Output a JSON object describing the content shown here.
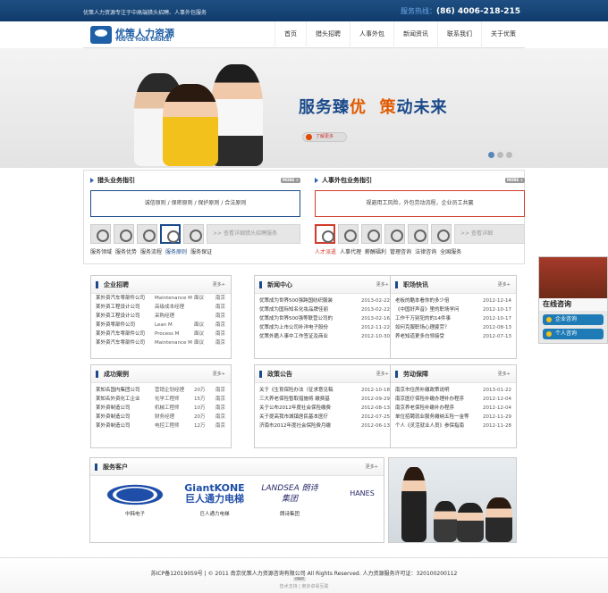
{
  "topbar": {
    "tagline": "优策人力资源专注于中高端猎头招聘、人事外包服务",
    "hotline_label": "服务热线：",
    "hotline_number": "(86) 4006-218-215"
  },
  "logo": {
    "cn": "优策人力资源",
    "en": "YOU'CE YOUR CHOICE!"
  },
  "nav": {
    "items": [
      "首页",
      "猎头招聘",
      "人事外包",
      "新闻资讯",
      "联系我们",
      "关于优策"
    ]
  },
  "hero": {
    "slogan_a": "服务臻",
    "slogan_b": "优",
    "slogan_c": "策",
    "slogan_d": "动未来",
    "more_label": "了解更多"
  },
  "headhunt": {
    "title": "猎头业务指引",
    "more": "MORE +",
    "principles": "诚信原则 / 保密原则 / 保护原则 / 合法原则",
    "view_label": ">> 查看详细猎头招聘服务",
    "labels": [
      "服务领域",
      "服务优势",
      "服务流程",
      "服务原则",
      "服务保证"
    ]
  },
  "outsourcing": {
    "title": "人事外包业务指引",
    "more": "MORE +",
    "principles": "规避用工风险，外包劳动流程，企业员工共赢",
    "view_label": ">> 查看详细",
    "labels": [
      "人才派遣",
      "人事代理",
      "薪酬福利",
      "管理咨询",
      "法律咨询",
      "全国服务"
    ]
  },
  "jobs": {
    "title": "企业招聘",
    "more": "更多+",
    "rows": [
      {
        "company": "某外资汽车零部件公司",
        "position": "Maintenance M",
        "type": "面议",
        "city": "南京"
      },
      {
        "company": "某外资工程设计公司",
        "position": "高级成本经理",
        "type": "",
        "city": "南京"
      },
      {
        "company": "某外资工程设计公司",
        "position": "采购经理",
        "type": "",
        "city": "南京"
      },
      {
        "company": "某外资零部件公司",
        "position": "Lean M",
        "type": "面议",
        "city": "南京"
      },
      {
        "company": "某外资汽车零部件公司",
        "position": "Process M",
        "type": "面议",
        "city": "南京"
      },
      {
        "company": "某外资汽车零部件公司",
        "position": "Maintenance M",
        "type": "面议",
        "city": "南京"
      }
    ]
  },
  "news": {
    "title": "新闻中心",
    "more": "更多+",
    "rows": [
      {
        "title": "优策成为世界500强跨国纺织服装",
        "date": "2013-02-22"
      },
      {
        "title": "优策成为国际知名化妆品牌佳丽",
        "date": "2013-02-22"
      },
      {
        "title": "优策成为世界500强等联营公司的",
        "date": "2013-02-16"
      },
      {
        "title": "优策成为上市公司补洋电子股份",
        "date": "2012-11-22"
      },
      {
        "title": "优策外籍人事中工作签证及商业",
        "date": "2012-10-30"
      }
    ]
  },
  "express": {
    "title": "职场快讯",
    "more": "更多+",
    "rows": [
      {
        "title": "老板的酷本看你的多少倍",
        "date": "2012-12-14"
      },
      {
        "title": "《中国好声音》里的职场学问",
        "date": "2012-10-17"
      },
      {
        "title": "工作千万别犯的的14件事",
        "date": "2012-10-17"
      },
      {
        "title": "如何克服职场心理疲劳？",
        "date": "2012-08-13"
      },
      {
        "title": "养老知道更多白领接受",
        "date": "2012-07-13"
      }
    ]
  },
  "cases": {
    "title": "成功案例",
    "more": "更多+",
    "rows": [
      {
        "company": "某知名国内集团公司",
        "position": "营销企划经理",
        "salary": "20万",
        "city": "南京"
      },
      {
        "company": "某知名外资化工企业",
        "position": "化学工程师",
        "salary": "15万",
        "city": "南京"
      },
      {
        "company": "某外资制造公司",
        "position": "机械工程师",
        "salary": "10万",
        "city": "南京"
      },
      {
        "company": "某外资制造公司",
        "position": "财务经理",
        "salary": "20万",
        "city": "南京"
      },
      {
        "company": "某外资制造公司",
        "position": "电控工程师",
        "salary": "12万",
        "city": "南京"
      }
    ]
  },
  "policy": {
    "title": "政策公告",
    "more": "更多+",
    "rows": [
      {
        "title": "关于《生育保险办法（征求意见稿",
        "date": "2012-10-18"
      },
      {
        "title": "三大养老保险暂取措施将 缴费基",
        "date": "2012-09-29"
      },
      {
        "title": "关于公布2012年度社会保险缴费",
        "date": "2012-08-13"
      },
      {
        "title": "关于提高我市城镇居民基本医疗",
        "date": "2012-07-25"
      },
      {
        "title": "济南市2012年度社会保险费月缴",
        "date": "2012-06-13"
      }
    ]
  },
  "labor": {
    "title": "劳动保障",
    "more": "更多+",
    "rows": [
      {
        "title": "南京市住房补缴政策说明",
        "date": "2013-01-22"
      },
      {
        "title": "南京医疗保险补缴办理补办程序",
        "date": "2012-12-04"
      },
      {
        "title": "南京养老保险补缴补办程序",
        "date": "2012-12-04"
      },
      {
        "title": "单位招聘就业服务缴纳五险一金等",
        "date": "2012-11-29"
      },
      {
        "title": "个人《灵活就业人员》参保指南",
        "date": "2012-11-28"
      }
    ]
  },
  "clients": {
    "title": "服务客户",
    "more": "更多+",
    "items": [
      {
        "logo": "",
        "name": "中韩电子"
      },
      {
        "logo": "GiantKONE 巨人通力电梯",
        "name": "巨人通力电梯"
      },
      {
        "logo": "LANDSEA 朗诗集团",
        "name": "朗诗集团"
      },
      {
        "logo": "HANES",
        "name": ""
      }
    ]
  },
  "side": {
    "title": "在线咨询",
    "btn1": "企业咨询",
    "btn2": "个人咨询"
  },
  "footer": {
    "line": "苏ICP备12019059号 | © 2011 南京优策人力资源咨询有限公司 All Rights Reserved.   人力资源服务许可证：320100200112",
    "badge": "CNZZ",
    "line2": "技术支持 | 南京卓易互联"
  },
  "colors": {
    "brand": "#1b4a8a",
    "accent": "#e15a00",
    "alert": "#d23a2a"
  }
}
